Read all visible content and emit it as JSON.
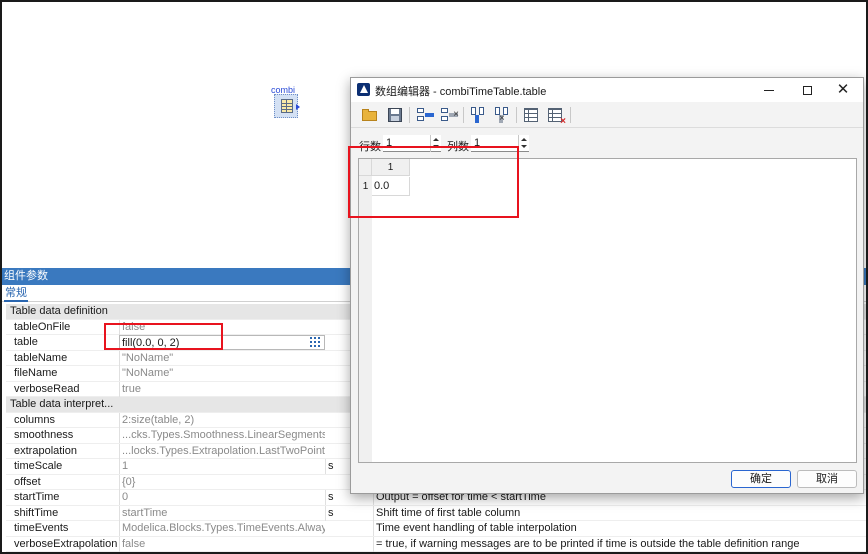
{
  "canvas": {
    "component_label": "combi"
  },
  "param_panel": {
    "title": "组件参数",
    "tab": "常规",
    "groups": [
      {
        "title": "Table data definition",
        "rows": [
          {
            "name": "tableOnFile",
            "value": "false",
            "unit": "",
            "desc": ""
          },
          {
            "name": "table",
            "value": "fill(0.0, 0, 2)",
            "unit": "",
            "desc": ""
          },
          {
            "name": "tableName",
            "value": "\"NoName\"",
            "unit": "",
            "desc": ""
          },
          {
            "name": "fileName",
            "value": "\"NoName\"",
            "unit": "",
            "desc": ""
          },
          {
            "name": "verboseRead",
            "value": "true",
            "unit": "",
            "desc": ""
          }
        ]
      },
      {
        "title": "Table data interpret...",
        "rows": [
          {
            "name": "columns",
            "value": "2:size(table, 2)",
            "unit": "",
            "desc": ""
          },
          {
            "name": "smoothness",
            "value": "...cks.Types.Smoothness.LinearSegments",
            "unit": "",
            "desc": ""
          },
          {
            "name": "extrapolation",
            "value": "...locks.Types.Extrapolation.LastTwoPoints",
            "unit": "",
            "desc": ""
          },
          {
            "name": "timeScale",
            "value": "1",
            "unit": "s",
            "desc": ""
          },
          {
            "name": "offset",
            "value": "{0}",
            "unit": "",
            "desc": ""
          },
          {
            "name": "startTime",
            "value": "0",
            "unit": "s",
            "desc": "Output = offset for time < startTime"
          },
          {
            "name": "shiftTime",
            "value": "startTime",
            "unit": "s",
            "desc": "Shift time of first table column"
          },
          {
            "name": "timeEvents",
            "value": "Modelica.Blocks.Types.TimeEvents.Always",
            "unit": "",
            "desc": "Time event handling of table interpolation"
          },
          {
            "name": "verboseExtrapolation",
            "value": "false",
            "unit": "",
            "desc": "= true, if warning messages are to be printed if time is outside the table definition range"
          }
        ]
      }
    ]
  },
  "dialog": {
    "title": "数组编辑器 - combiTimeTable.table",
    "rows_label": "行数",
    "rows_value": "1",
    "cols_label": "列数",
    "cols_value": "1",
    "grid": {
      "column_headers": [
        "1"
      ],
      "row_headers": [
        "1"
      ],
      "cells": [
        [
          "0.0"
        ]
      ]
    },
    "ok_label": "确定",
    "cancel_label": "取消",
    "toolbar": [
      "folder-open-icon",
      "save-icon",
      "insert-row-icon",
      "delete-row-icon",
      "insert-column-icon",
      "delete-column-icon",
      "insert-table-icon",
      "delete-table-icon"
    ]
  },
  "colors": {
    "accent": "#3a79bf",
    "highlight": "#e8131e",
    "link_blue": "#2a4bd7"
  }
}
